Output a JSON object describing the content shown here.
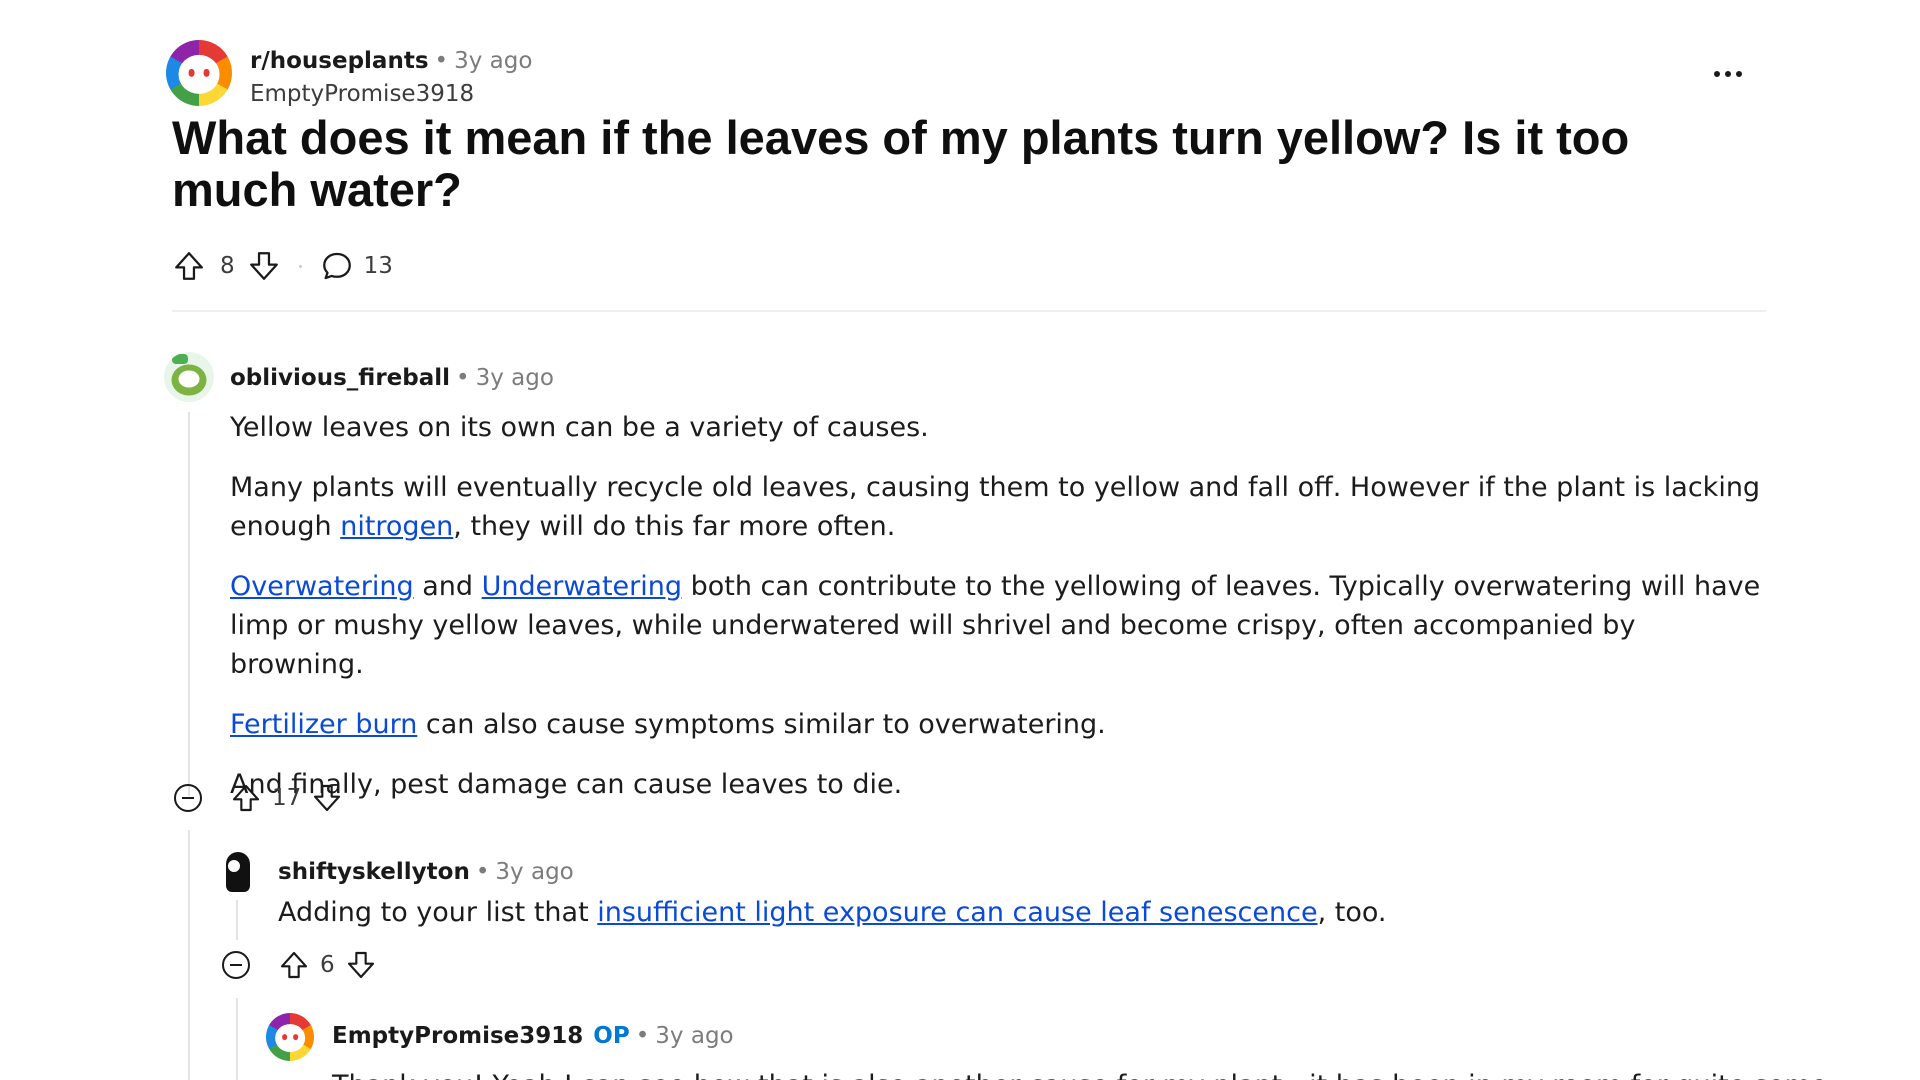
{
  "post": {
    "subreddit": "r/houseplants",
    "separator": "•",
    "time": "3y ago",
    "author": "EmptyPromise3918",
    "title": "What does it mean if the leaves of my plants turn yellow? Is it too much water?",
    "upvotes": "8",
    "comments": "13"
  },
  "comments": [
    {
      "author": "oblivious_fireball",
      "separator": "•",
      "time": "3y ago",
      "paragraphs": {
        "p1": "Yellow leaves on its own can be a variety of causes.",
        "p2_a": "Many plants will eventually recycle old leaves, causing them to yellow and fall off. However if the plant is lacking enough ",
        "p2_link": "nitrogen",
        "p2_b": ", they will do this far more often.",
        "p3_link1": "Overwatering",
        "p3_mid": " and ",
        "p3_link2": "Underwatering",
        "p3_b": " both can contribute to the yellowing of leaves. Typically overwatering will have limp or mushy yellow leaves, while underwatered will shrivel and become crispy, often accompanied by browning.",
        "p4_link": "Fertilizer burn",
        "p4_b": " can also cause symptoms similar to overwatering.",
        "p5": "And finally, pest damage can cause leaves to die."
      },
      "votes": "17"
    },
    {
      "author": "shiftyskellyton",
      "separator": "•",
      "time": "3y ago",
      "text_a": "Adding to your list that ",
      "link": "insufficient light exposure can cause leaf senescence",
      "text_b": ", too.",
      "votes": "6"
    },
    {
      "author": "EmptyPromise3918",
      "badge": "OP",
      "separator": "•",
      "time": "3y ago",
      "text_partial": "Thank you! Yeah I can see how that is also another cause for my plant - it has been in my room for quite some"
    }
  ],
  "icons": {
    "upvote": "upvote-arrow-icon",
    "downvote": "downvote-arrow-icon",
    "comment": "comment-bubble-icon",
    "more": "more-options-icon",
    "collapse": "collapse-thread-icon"
  },
  "colors": {
    "link": "#0a4ad6",
    "op_badge": "#0079d3",
    "meta_gray": "#7c7c7c"
  }
}
